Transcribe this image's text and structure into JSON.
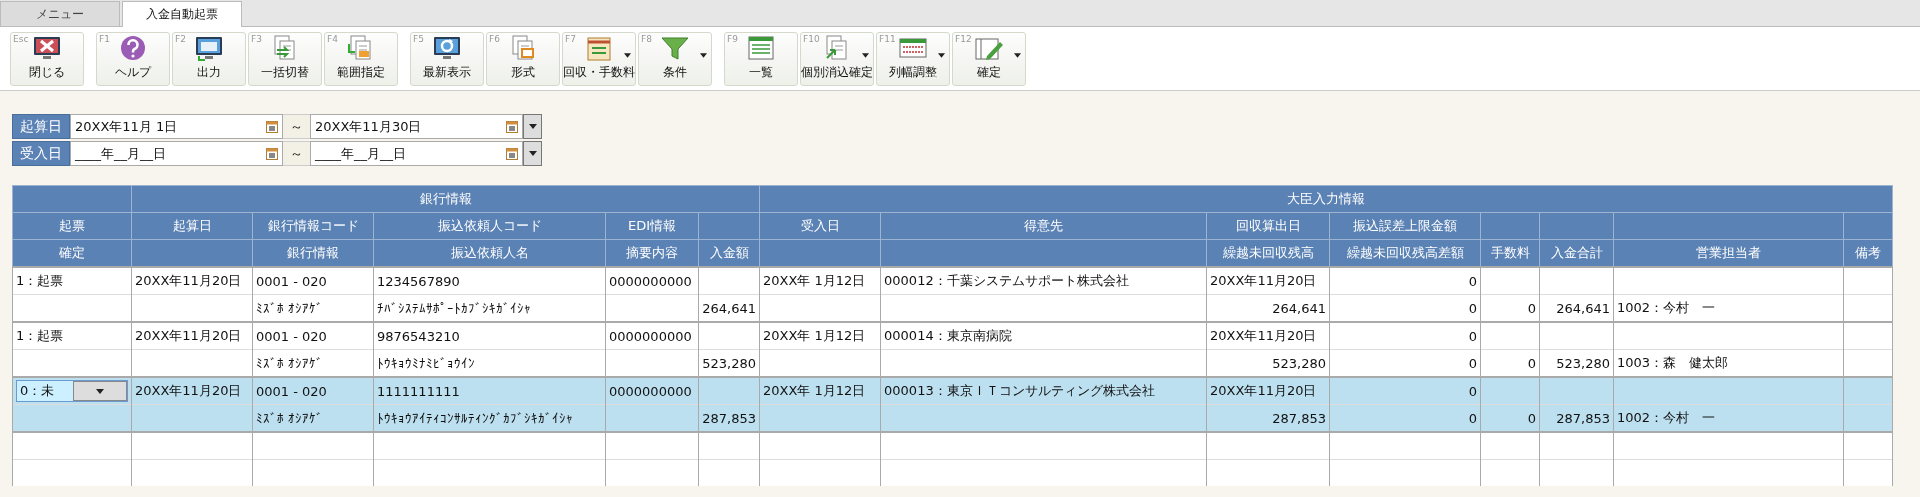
{
  "tabs": [
    {
      "label": "メニュー",
      "selected": false
    },
    {
      "label": "入金自動起票",
      "selected": true
    }
  ],
  "toolbar": [
    {
      "buttons": [
        {
          "key": "Esc",
          "label": "閉じる",
          "kind": "close",
          "menu": false
        }
      ]
    },
    {
      "buttons": [
        {
          "key": "F1",
          "label": "ヘルプ",
          "kind": "help",
          "menu": false
        },
        {
          "key": "F2",
          "label": "出力",
          "kind": "output",
          "menu": false
        },
        {
          "key": "F3",
          "label": "一括切替",
          "kind": "switch",
          "menu": false
        },
        {
          "key": "F4",
          "label": "範囲指定",
          "kind": "range",
          "menu": false
        }
      ]
    },
    {
      "buttons": [
        {
          "key": "F5",
          "label": "最新表示",
          "kind": "refresh",
          "menu": false
        },
        {
          "key": "F6",
          "label": "形式",
          "kind": "format",
          "menu": false
        },
        {
          "key": "F7",
          "label": "回収・手数料",
          "kind": "notebook",
          "menu": true
        },
        {
          "key": "F8",
          "label": "条件",
          "kind": "filter",
          "menu": true
        }
      ]
    },
    {
      "buttons": [
        {
          "key": "F9",
          "label": "一覧",
          "kind": "list",
          "menu": false
        },
        {
          "key": "F10",
          "label": "個別消込確定",
          "kind": "confirm",
          "menu": true
        },
        {
          "key": "F11",
          "label": "列幅調整",
          "kind": "columns",
          "menu": true
        },
        {
          "key": "F12",
          "label": "確定",
          "kind": "edit",
          "menu": true
        }
      ]
    }
  ],
  "filters": [
    {
      "label": "起算日",
      "from": "20XX年11月 1日",
      "separator": "～",
      "to": "20XX年11月30日"
    },
    {
      "label": "受入日",
      "from": "____年__月__日",
      "separator": "～",
      "to": "____年__月__日"
    }
  ],
  "table": {
    "column_groups": [
      {
        "columns": [
          {
            "top": "起票",
            "bottom": "確定"
          }
        ]
      },
      {
        "label": "銀行情報",
        "columns": [
          {
            "top": "起算日"
          },
          {
            "top": "銀行情報コード",
            "bottom": "銀行情報"
          },
          {
            "top": "振込依頼人コード",
            "bottom": "振込依頼人名"
          },
          {
            "top": "EDI情報",
            "bottom": "摘要内容"
          },
          {
            "bottom": "入金額"
          }
        ]
      },
      {
        "label": "大臣入力情報",
        "columns": [
          {
            "top": "受入日"
          },
          {
            "top": "得意先"
          },
          {
            "top": "回収算出日",
            "bottom": "繰越未回収残高"
          },
          {
            "top": "振込誤差上限金額",
            "bottom": "繰越未回収残高差額"
          },
          {
            "bottom": "手数料"
          },
          {
            "bottom": "入金合計"
          },
          {
            "bottom": "営業担当者"
          },
          {
            "bottom": "備考"
          }
        ]
      }
    ],
    "rows": [
      {
        "selected": false,
        "status": "1：起票",
        "start_date": "20XX年11月20日",
        "bank_code": "0001 - 020",
        "sender_code": "1234567890",
        "edi": "0000000000",
        "received_date": "20XX年 1月12日",
        "customer": "000012：千葉システムサポート株式会社",
        "calc_date": "20XX年11月20日",
        "error_limit": "0",
        "bank_name": "ﾐｽﾞﾎ ｵｼｱｹﾞ",
        "sender_name": "ﾁﾊﾞｼｽﾃﾑｻﾎﾟｰﾄｶﾌﾞｼｷｶﾞｲｼｬ",
        "amount": "264,641",
        "carryover": "264,641",
        "carryover_diff": "0",
        "fee": "0",
        "total": "264,641",
        "staff": "1002：今村　一"
      },
      {
        "selected": false,
        "status": "1：起票",
        "start_date": "20XX年11月20日",
        "bank_code": "0001 - 020",
        "sender_code": "9876543210",
        "edi": "0000000000",
        "received_date": "20XX年 1月12日",
        "customer": "000014：東京南病院",
        "calc_date": "20XX年11月20日",
        "error_limit": "0",
        "bank_name": "ﾐｽﾞﾎ ｵｼｱｹﾞ",
        "sender_name": "ﾄｳｷｮｳﾐﾅﾐﾋﾞｮｳｲﾝ",
        "amount": "523,280",
        "carryover": "523,280",
        "carryover_diff": "0",
        "fee": "0",
        "total": "523,280",
        "staff": "1003：森　健太郎"
      },
      {
        "selected": true,
        "status": "0：未",
        "start_date": "20XX年11月20日",
        "bank_code": "0001 - 020",
        "sender_code": "1111111111",
        "edi": "0000000000",
        "received_date": "20XX年 1月12日",
        "customer": "000013：東京ＩＴコンサルティング株式会社",
        "calc_date": "20XX年11月20日",
        "error_limit": "0",
        "bank_name": "ﾐｽﾞﾎ ｵｼｱｹﾞ",
        "sender_name": "ﾄｳｷｮｳｱｲﾃｨｺﾝｻﾙﾃｨﾝｸﾞｶﾌﾞｼｷｶﾞｲｼｬ",
        "amount": "287,853",
        "carryover": "287,853",
        "carryover_diff": "0",
        "fee": "0",
        "total": "287,853",
        "staff": "1002：今村　一"
      }
    ]
  }
}
